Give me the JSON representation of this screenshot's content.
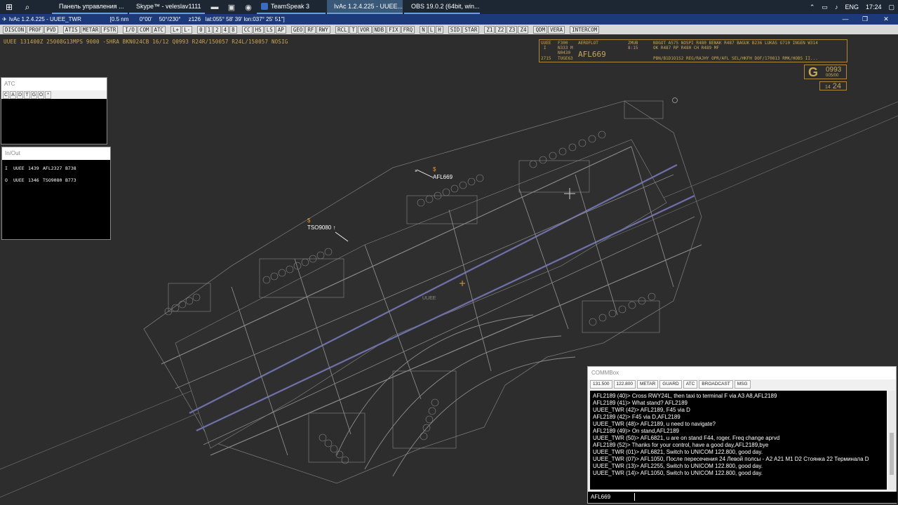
{
  "taskbar": {
    "apps": [
      {
        "label": "Панель управления ...",
        "color": "#e8b53a",
        "active": false
      },
      {
        "label": "Skype™ - veleslav1111",
        "color": "#2aa6e0",
        "active": false
      },
      {
        "label": "TeamSpeak 3",
        "color": "#3a6cc0",
        "active": false
      },
      {
        "label": "IvAc 1.2.4.225 - UUEE...",
        "color": "#4a80c0",
        "active": true
      },
      {
        "label": "OBS 19.0.2 (64bit, win...",
        "color": "#555555",
        "active": false
      }
    ],
    "tray": {
      "lang": "ENG",
      "time": "17:24"
    }
  },
  "titlebar": {
    "app": "IvAc 1.2.4.225 - UUEE_TWR",
    "range": "[0.5 nm",
    "rotation": "0°00'",
    "wind": "50°/230°",
    "zoom": "z126",
    "coords": "lat:055° 58' 39' lon:037° 25' 51\"]"
  },
  "toolbar": {
    "buttons": [
      "DISCON",
      "PROF",
      "PVD",
      "ATIS",
      "METAR",
      "FSTR",
      "I/O",
      "COM",
      "ATC",
      "L+",
      "L-",
      "0",
      "1",
      "2",
      "4",
      "8",
      "CC",
      "HS",
      "LS",
      "AP",
      "GEO",
      "RF",
      "RWY",
      "RCL",
      "T",
      "VOR",
      "NDB",
      "FIX",
      "FRQ",
      "N",
      "L",
      "H",
      "SID",
      "STAR",
      "Z1",
      "Z2",
      "Z3",
      "Z4",
      "QDM",
      "VERA",
      "INTERCOM"
    ]
  },
  "metar": "UUEE 131400Z 25008G13MPS 9000 -SHRA BKN024CB 16/12 Q0993 R24R/150057 R24L/150057 NOSIG",
  "strip": {
    "dep": "UUEE",
    "type": "I",
    "fl": "F300",
    "speed": "N333 M",
    "sq": "N0430",
    "code": "2715",
    "sid": "TUGE63",
    "airline": "AEROFLOT",
    "callsign": "AFL669",
    "dest": "ZMUB",
    "eta": "8:15",
    "route1": "NOGOT A575 NOSPI R480 BENAK R487 BAGUK B236 LUKAS G710 INGEN W314",
    "route2": "OK R487 RP R480 CH R489 MF",
    "remarks": "PBN/B1D1O1S2 REG/RAJHY OPR/AFL SEL/HKFH DOF/170813 RMK/HOBS II..."
  },
  "qnh": {
    "letter": "G",
    "value": "0993",
    "wind": "005/00"
  },
  "clock": {
    "hour": "14",
    "minute": "24"
  },
  "aircraft": [
    {
      "callsign": "AFL669"
    },
    {
      "callsign": "TSO9080 ↑"
    }
  ],
  "airport_label": "UUEE",
  "atc_pane": {
    "title": "ATC",
    "tabs": [
      "C",
      "A",
      "D",
      "T",
      "G",
      "O",
      "*"
    ]
  },
  "inout_pane": {
    "title": "In/Out",
    "rows": [
      {
        "dir": "I",
        "apt": "UUEE",
        "time": "1439",
        "cs": "AFL2327",
        "type": "B738"
      },
      {
        "dir": "O",
        "apt": "UUEE",
        "time": "1346",
        "cs": "TSO9080",
        "type": "B773"
      }
    ]
  },
  "commbox": {
    "title": "COMMBox",
    "tabs": [
      "131.500",
      "122.800",
      "METAR",
      "GUARD",
      "ATC",
      "BROADCAST",
      "MSG"
    ],
    "lines": [
      "AFL2189 (40)> Cross RWY24L, then taxi to terminal F via A3 A8,AFL2189",
      "AFL2189 (41)> What stand? AFL2189",
      "UUEE_TWR (42)> AFL2189, F45 via D",
      "AFL2189 (42)> F45 via D,AFL2189",
      "UUEE_TWR (48)> AFL2189, u need to navigate?",
      "AFL2189 (49)> On stand,AFL2189",
      "UUEE_TWR (50)> AFL6821, u are on stand F44, roger. Freq change aprvd",
      "AFL2189 (52)> Thanks for your control, have a good day,AFL2189,bye",
      "UUEE_TWR (01)> AFL6821, Switch to UNICOM 122.800, good day.",
      "UUEE_TWR (07)> AFL1050, После пересечения 24 Левой полсы - A2 A21 M1 D2 Стоянка 22 Терминала D",
      "UUEE_TWR (13)> AFL2255, Switch to UNICOM 122.800, good day.",
      "UUEE_TWR (14)> AFL1050, Switch to UNICOM 122.800, good day."
    ],
    "input": "AFL669"
  }
}
